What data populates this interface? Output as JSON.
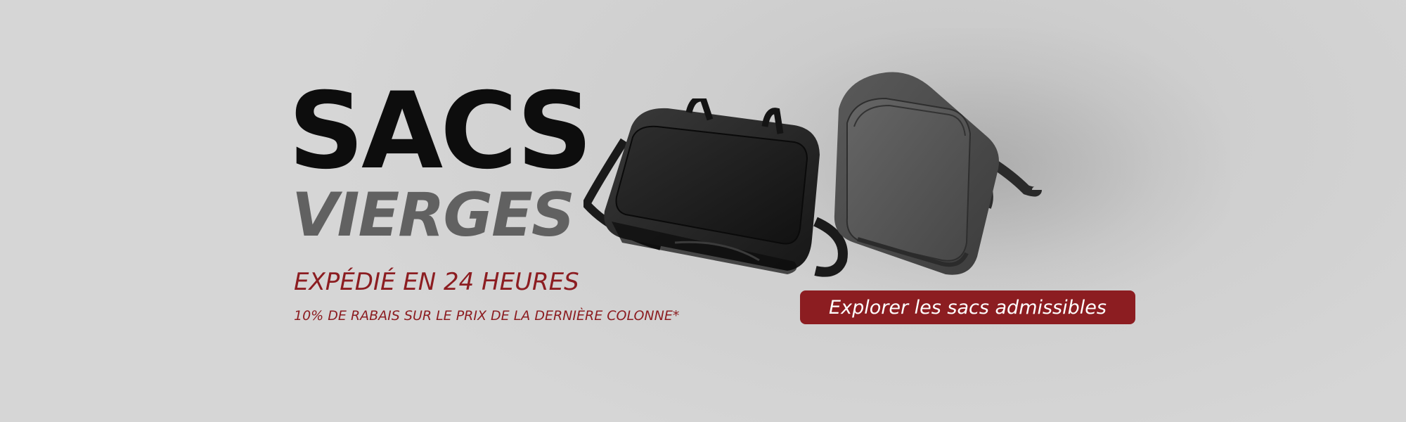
{
  "banner": {
    "headline_main": "SACS",
    "headline_sub": "VIERGES",
    "tagline": "EXPÉDIÉ EN 24 HEURES",
    "discount": "10% DE RABAIS SUR LE PRIX DE LA DERNIÈRE COLONNE*",
    "cta_label": "Explorer les sacs admissibles"
  },
  "colors": {
    "background": "#d3d3d3",
    "headline_main": "#0d0d0d",
    "headline_sub": "#616161",
    "accent": "#8c1d21",
    "cta_text": "#ffffff"
  },
  "images": {
    "left": "black-duffel-bag",
    "right": "gray-laptop-backpack"
  }
}
